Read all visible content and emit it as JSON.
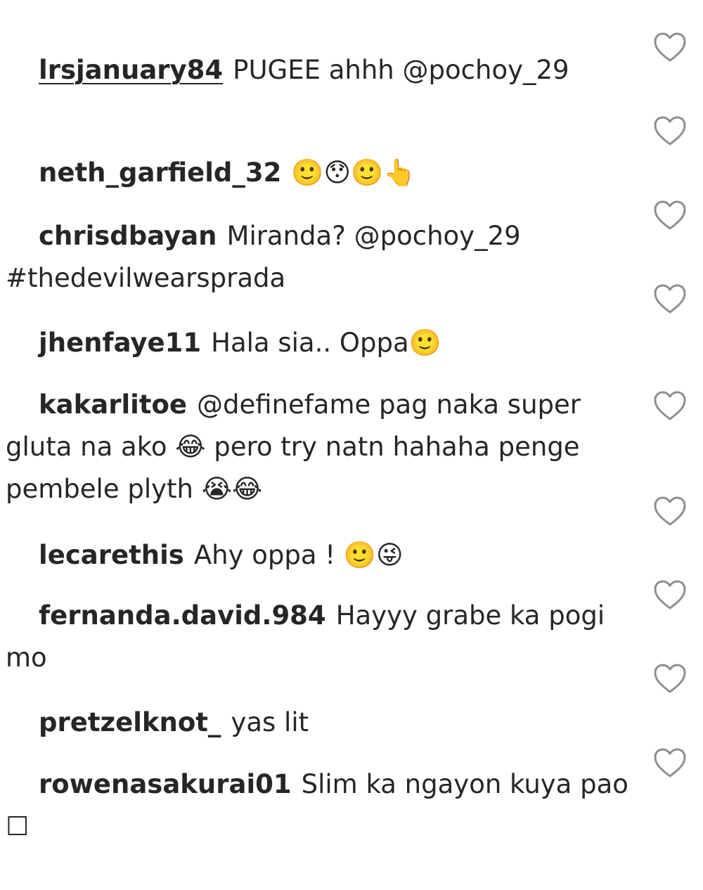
{
  "comments": [
    {
      "username": "lrsjanuary84",
      "text": "PUGEE ahhh @pochoy_29",
      "liked": false
    },
    {
      "username": "neth_garfield_32",
      "text": "🙂😯🙂👆",
      "liked": false
    },
    {
      "username": "chrisdbayan",
      "text": "Miranda? @pochoy_29 #thedevilwearsprada",
      "liked": false
    },
    {
      "username": "jhenfaye11",
      "text": "Hala sia.. Oppa🙂",
      "liked": false
    },
    {
      "username": "kakarlitoe",
      "text": "@definefame pag naka super gluta na ako 😂 pero try natn hahaha penge pembele plyth 😭😂",
      "liked": false
    },
    {
      "username": "lecarethis",
      "text": "Ahy oppa ! 🙂😜",
      "liked": false
    },
    {
      "username": "fernanda.david.984",
      "text": "Hayyy grabe ka pogi mo",
      "liked": false
    },
    {
      "username": "pretzelknot_",
      "text": "yas lit",
      "liked": false
    },
    {
      "username": "rowenasakurai01",
      "text": "Slim ka ngayon kuya pao ☐",
      "liked": false
    }
  ],
  "icons": {
    "like": "heart-outline-icon"
  },
  "colors": {
    "text": "#262626",
    "heart_stroke": "#8e8e8e",
    "background": "#ffffff"
  }
}
